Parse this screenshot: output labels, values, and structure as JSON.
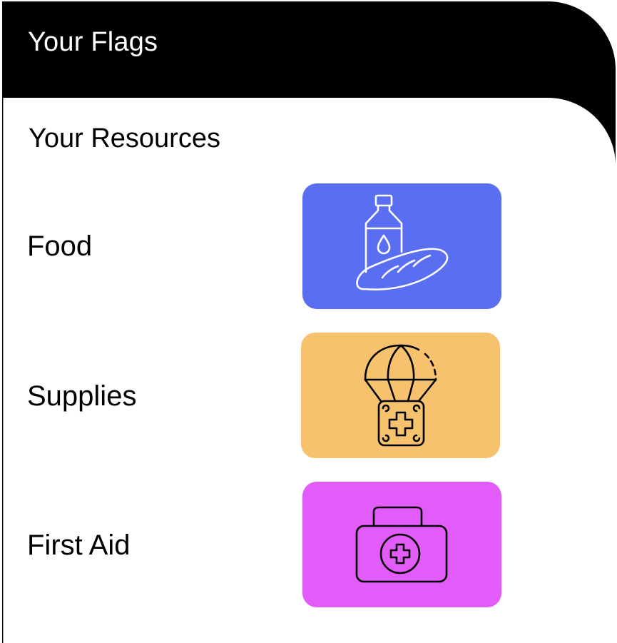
{
  "header": {
    "title": "Your Flags"
  },
  "main": {
    "section_title": "Your Resources",
    "resources": [
      {
        "label": "Food",
        "icon": "bread-and-bottle-icon",
        "color": "#5a6ef2"
      },
      {
        "label": "Supplies",
        "icon": "parachute-supply-drop-icon",
        "color": "#f6c26e"
      },
      {
        "label": "First Aid",
        "icon": "first-aid-kit-icon",
        "color": "#e25cf9"
      }
    ]
  },
  "colors": {
    "header_bg": "#000000",
    "panel_bg": "#ffffff",
    "text": "#000000",
    "header_text": "#ffffff"
  }
}
